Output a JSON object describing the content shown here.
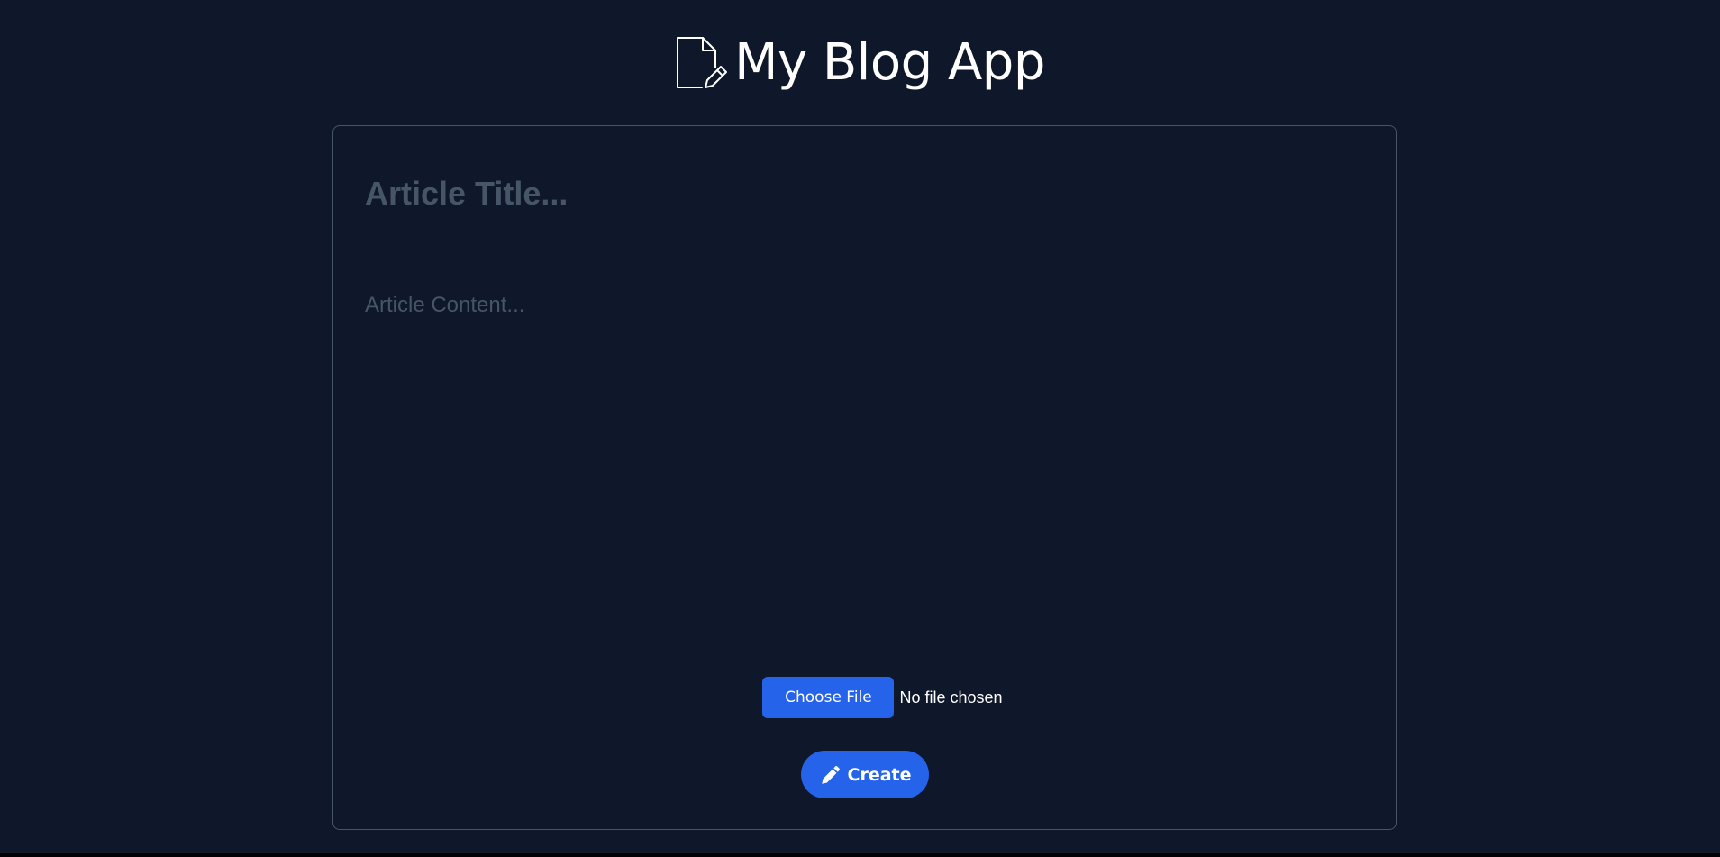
{
  "header": {
    "title": "My Blog App",
    "icon": "document-edit-icon"
  },
  "form": {
    "title_placeholder": "Article Title...",
    "title_value": "",
    "content_placeholder": "Article Content...",
    "content_value": "",
    "file_button_label": "Choose File",
    "file_status": "No file chosen",
    "create_label": "Create",
    "create_icon": "pencil-icon"
  },
  "colors": {
    "background": "#0f172a",
    "accent": "#2563eb",
    "border": "#475569",
    "placeholder": "#475569",
    "text": "#ffffff"
  }
}
